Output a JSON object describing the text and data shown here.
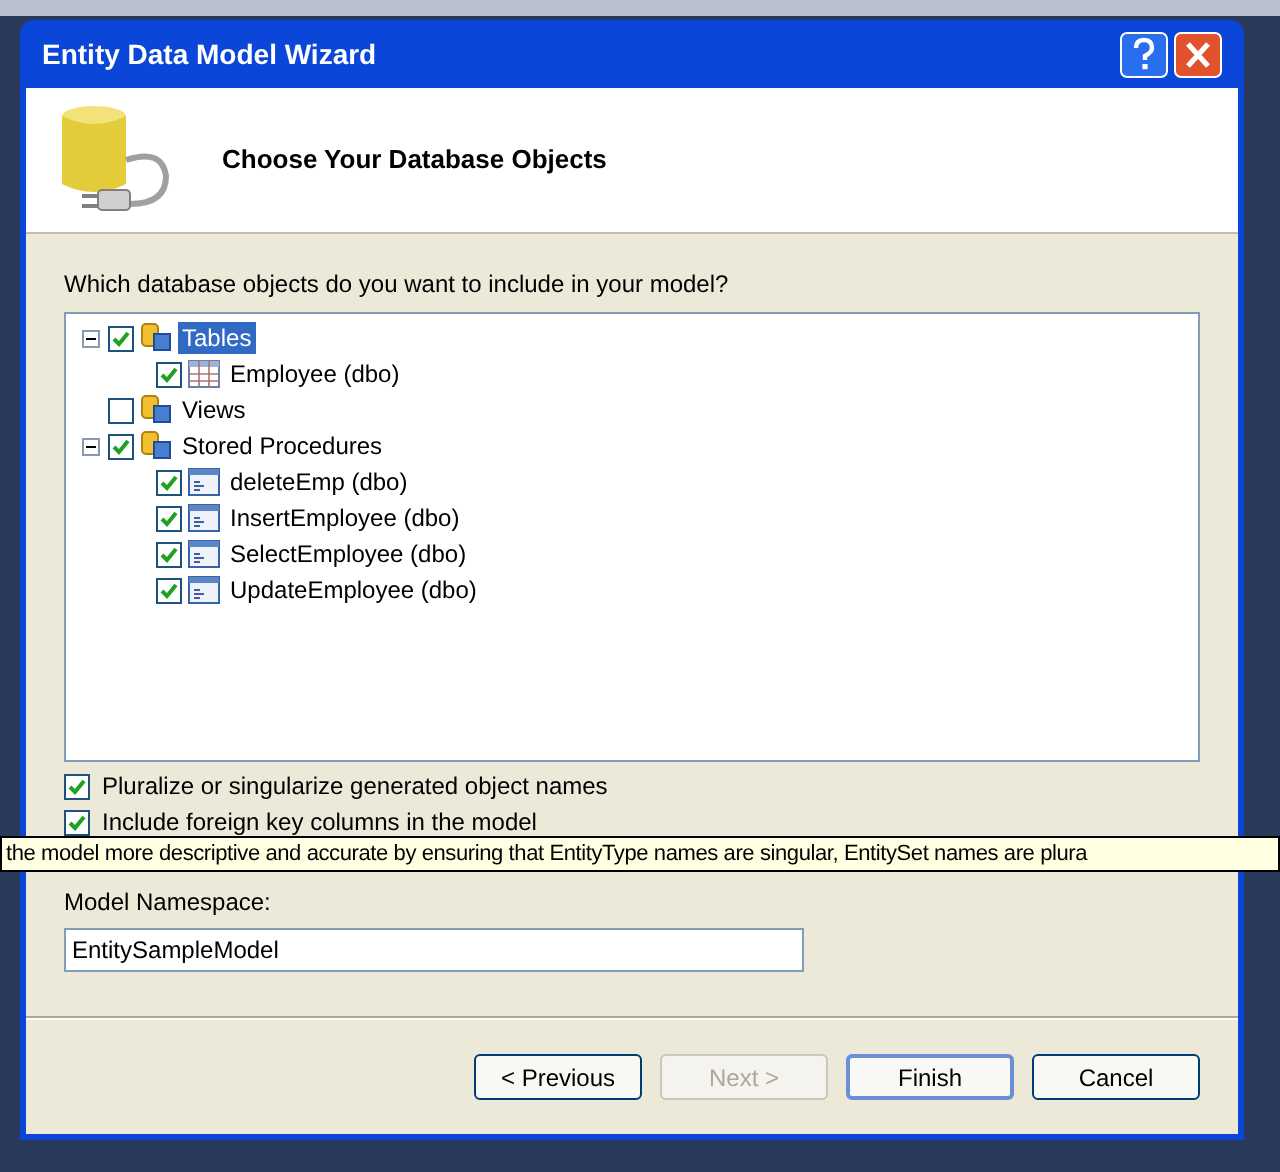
{
  "window": {
    "title": "Entity Data Model Wizard"
  },
  "header": {
    "title": "Choose Your Database Objects"
  },
  "prompt": "Which database objects do you want to include in your model?",
  "tree": [
    {
      "label": "Tables",
      "kind": "folder",
      "checked": true,
      "expanded": true,
      "selected": true,
      "children": [
        {
          "label": "Employee (dbo)",
          "kind": "table",
          "checked": true,
          "selected": false
        }
      ]
    },
    {
      "label": "Views",
      "kind": "folder",
      "checked": false,
      "selected": false
    },
    {
      "label": "Stored Procedures",
      "kind": "folder",
      "checked": true,
      "expanded": true,
      "selected": false,
      "children": [
        {
          "label": "deleteEmp (dbo)",
          "kind": "procedure",
          "checked": true,
          "selected": false
        },
        {
          "label": "InsertEmployee (dbo)",
          "kind": "procedure",
          "checked": true,
          "selected": false
        },
        {
          "label": "SelectEmployee (dbo)",
          "kind": "procedure",
          "checked": true,
          "selected": false
        },
        {
          "label": "UpdateEmployee (dbo)",
          "kind": "procedure",
          "checked": true,
          "selected": false
        }
      ]
    }
  ],
  "options": [
    {
      "label": "Pluralize or singularize generated object names",
      "checked": true
    },
    {
      "label": "Include foreign key columns in the model",
      "checked": true
    }
  ],
  "tooltip": "the model more descriptive and accurate by ensuring that EntityType names are singular, EntitySet names are plura",
  "namespace": {
    "label": "Model Namespace:",
    "value": "EntitySampleModel"
  },
  "buttons": [
    {
      "label": "< Previous",
      "disabled": false,
      "default": false
    },
    {
      "label": "Next >",
      "disabled": true,
      "default": false
    },
    {
      "label": "Finish",
      "disabled": false,
      "default": true
    },
    {
      "label": "Cancel",
      "disabled": false,
      "default": false
    }
  ]
}
